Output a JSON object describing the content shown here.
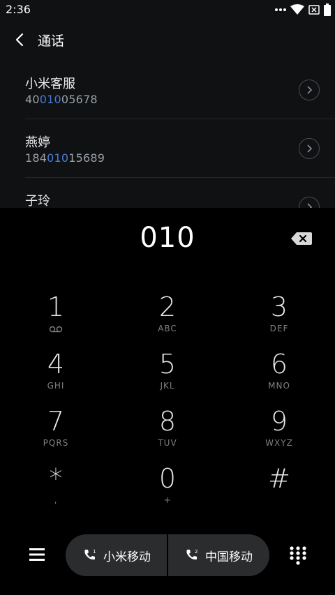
{
  "status": {
    "time": "2:36"
  },
  "header": {
    "title": "通话"
  },
  "results": [
    {
      "name": "小米客服",
      "number_pre": "40",
      "number_match": "010",
      "number_post": "05678"
    },
    {
      "name": "燕婷",
      "number_pre": "184",
      "number_match": "010",
      "number_post": "15689"
    },
    {
      "name": "子玲",
      "number_pre": "",
      "number_match": "",
      "number_post": ""
    }
  ],
  "dialer": {
    "input": "010",
    "keys": [
      {
        "digit": "1",
        "letters": ""
      },
      {
        "digit": "2",
        "letters": "ABC"
      },
      {
        "digit": "3",
        "letters": "DEF"
      },
      {
        "digit": "4",
        "letters": "GHI"
      },
      {
        "digit": "5",
        "letters": "JKL"
      },
      {
        "digit": "6",
        "letters": "MNO"
      },
      {
        "digit": "7",
        "letters": "PQRS"
      },
      {
        "digit": "8",
        "letters": "TUV"
      },
      {
        "digit": "9",
        "letters": "WXYZ"
      },
      {
        "digit": "*",
        "letters": ","
      },
      {
        "digit": "0",
        "letters": "+"
      },
      {
        "digit": "#",
        "letters": ""
      }
    ]
  },
  "bottom": {
    "sim1_label": "小米移动",
    "sim1_index": "1",
    "sim2_label": "中国移动",
    "sim2_index": "2"
  },
  "colors": {
    "highlight": "#4b7bd8",
    "background": "#000000",
    "panel": "#0f1113"
  }
}
